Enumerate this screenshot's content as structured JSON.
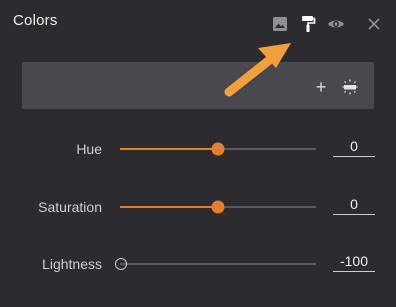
{
  "panel": {
    "title": "Colors"
  },
  "header_icons": {
    "image": "image-icon",
    "paint_roller": "paint-roller-icon",
    "eye": "eye-icon",
    "close": "close-icon"
  },
  "layer_box": {
    "plus_symbol": "+",
    "effect_icon": "layer-effect-icon"
  },
  "sliders": [
    {
      "label": "Hue",
      "value": "0",
      "fill_fraction": 0.5
    },
    {
      "label": "Saturation",
      "value": "0",
      "fill_fraction": 0.5
    },
    {
      "label": "Lightness",
      "value": "-100",
      "fill_fraction": 0.0
    }
  ],
  "colors": {
    "accent": "#e57f2a",
    "arrow": "#f2a13a",
    "background": "#2c2c30"
  }
}
